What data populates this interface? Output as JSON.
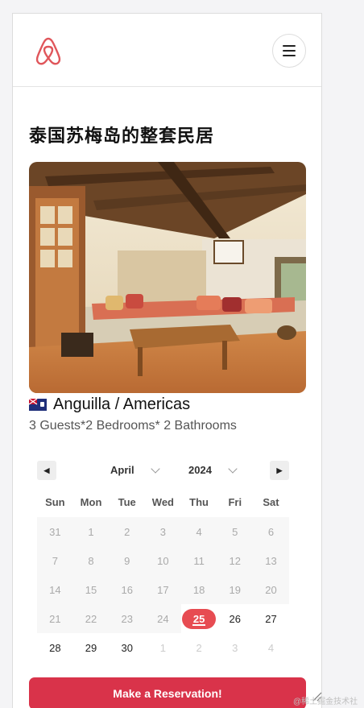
{
  "header": {
    "logo_icon": "airbnb-logo-icon",
    "menu_icon": "hamburger-icon"
  },
  "listing": {
    "title": "泰国苏梅岛的整套民居",
    "location": "Anguilla / Americas",
    "specs": "3 Guests*2 Bedrooms* 2 Bathrooms",
    "flag_icon": "anguilla-flag-icon"
  },
  "calendar": {
    "month": "April",
    "year": "2024",
    "prev_icon": "triangle-left-icon",
    "next_icon": "triangle-right-icon",
    "weekdays": [
      "Sun",
      "Mon",
      "Tue",
      "Wed",
      "Thu",
      "Fri",
      "Sat"
    ],
    "days": [
      {
        "d": "31",
        "state": "past"
      },
      {
        "d": "1",
        "state": "past"
      },
      {
        "d": "2",
        "state": "past"
      },
      {
        "d": "3",
        "state": "past"
      },
      {
        "d": "4",
        "state": "past"
      },
      {
        "d": "5",
        "state": "past"
      },
      {
        "d": "6",
        "state": "past"
      },
      {
        "d": "7",
        "state": "past"
      },
      {
        "d": "8",
        "state": "past"
      },
      {
        "d": "9",
        "state": "past"
      },
      {
        "d": "10",
        "state": "past"
      },
      {
        "d": "11",
        "state": "past"
      },
      {
        "d": "12",
        "state": "past"
      },
      {
        "d": "13",
        "state": "past"
      },
      {
        "d": "14",
        "state": "past"
      },
      {
        "d": "15",
        "state": "past"
      },
      {
        "d": "16",
        "state": "past"
      },
      {
        "d": "17",
        "state": "past"
      },
      {
        "d": "18",
        "state": "past"
      },
      {
        "d": "19",
        "state": "past"
      },
      {
        "d": "20",
        "state": "past"
      },
      {
        "d": "21",
        "state": "past"
      },
      {
        "d": "22",
        "state": "past"
      },
      {
        "d": "23",
        "state": "past"
      },
      {
        "d": "24",
        "state": "past"
      },
      {
        "d": "25",
        "state": "today"
      },
      {
        "d": "26",
        "state": "future"
      },
      {
        "d": "27",
        "state": "future"
      },
      {
        "d": "28",
        "state": "future"
      },
      {
        "d": "29",
        "state": "future"
      },
      {
        "d": "30",
        "state": "future"
      },
      {
        "d": "1",
        "state": "other"
      },
      {
        "d": "2",
        "state": "other"
      },
      {
        "d": "3",
        "state": "other"
      },
      {
        "d": "4",
        "state": "other"
      }
    ]
  },
  "cta": {
    "reserve_label": "Make a Reservation!"
  },
  "watermark": "@稀土掘金技术社区",
  "colors": {
    "brand": "#d9334a",
    "today": "#e74c52"
  }
}
